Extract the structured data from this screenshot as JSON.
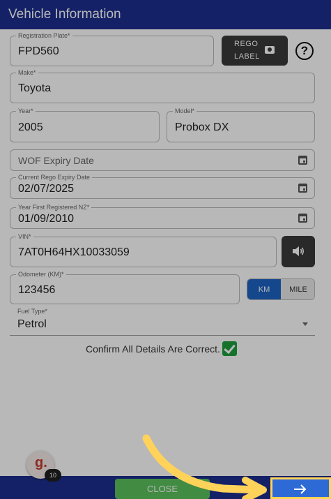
{
  "header": {
    "title": "Vehicle Information"
  },
  "fields": {
    "registration_plate": {
      "label": "Registration Plate*",
      "value": "FPD560"
    },
    "make": {
      "label": "Make*",
      "value": "Toyota"
    },
    "year": {
      "label": "Year*",
      "value": "2005"
    },
    "model": {
      "label": "Model*",
      "value": "Probox DX"
    },
    "wof_expiry": {
      "placeholder": "WOF Expiry Date"
    },
    "rego_expiry": {
      "label": "Current Rego Expiry Date",
      "value": "02/07/2025"
    },
    "year_first_registered": {
      "label": "Year First Registered NZ*",
      "value": "01/09/2010"
    },
    "vin": {
      "label": "VIN*",
      "value": "7AT0H64HX10033059"
    },
    "odometer": {
      "label": "Odometer (KM)*",
      "value": "123456"
    },
    "fuel_type": {
      "label": "Fuel Type*",
      "value": "Petrol"
    }
  },
  "rego_label_button": {
    "line1": "REGO",
    "line2": "LABEL",
    "icon": "camera-icon"
  },
  "help_button": {
    "glyph": "?"
  },
  "unit_toggle": {
    "km": "KM",
    "mile": "MILE",
    "selected": "KM"
  },
  "confirm": {
    "text": "Confirm All Details Are Correct.",
    "checked": true
  },
  "footer": {
    "close_label": "CLOSE",
    "next_icon": "arrow-right-icon"
  },
  "logo": {
    "glyph": "g.",
    "badge_count": "10"
  },
  "colors": {
    "header": "#1c2f8e",
    "accent": "#1e63c4",
    "close": "#5cc15e",
    "check": "#1e9e3c",
    "highlight": "#ffd25a"
  }
}
